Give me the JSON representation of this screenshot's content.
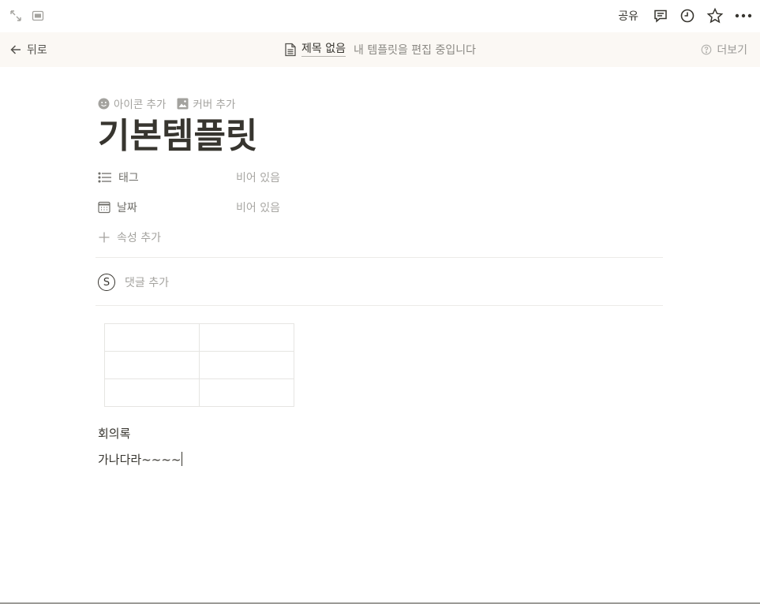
{
  "topbar": {
    "share_label": "공유",
    "icons": [
      "expand-icon",
      "peek-mode-icon",
      "comments-icon",
      "history-icon",
      "favorite-star-icon",
      "more-options-icon"
    ]
  },
  "template_bar": {
    "back_label": "뒤로",
    "doc_title": "제목 없음",
    "editing_text": "내 템플릿을 편집 중입니다",
    "more_label": "더보기"
  },
  "page": {
    "add_icon_label": "아이콘 추가",
    "add_cover_label": "커버 추가",
    "title": "기본템플릿",
    "properties": [
      {
        "name": "태그",
        "value": "비어 있음",
        "icon": "multi-select-icon"
      },
      {
        "name": "날짜",
        "value": "비어 있음",
        "icon": "calendar-icon"
      }
    ],
    "add_property_label": "속성 추가",
    "avatar_letter": "S",
    "comment_placeholder": "댓글 추가",
    "table": {
      "rows": 3,
      "cols": 2,
      "cells": [
        [
          "",
          ""
        ],
        [
          "",
          ""
        ],
        [
          "",
          ""
        ]
      ]
    },
    "blocks": [
      "회의록",
      "가나다라~~~~"
    ]
  },
  "colors": {
    "text": "#37352f",
    "muted": "#a3a29e",
    "template_bar_bg": "#fbf8f4",
    "border": "#e6e5e2"
  }
}
